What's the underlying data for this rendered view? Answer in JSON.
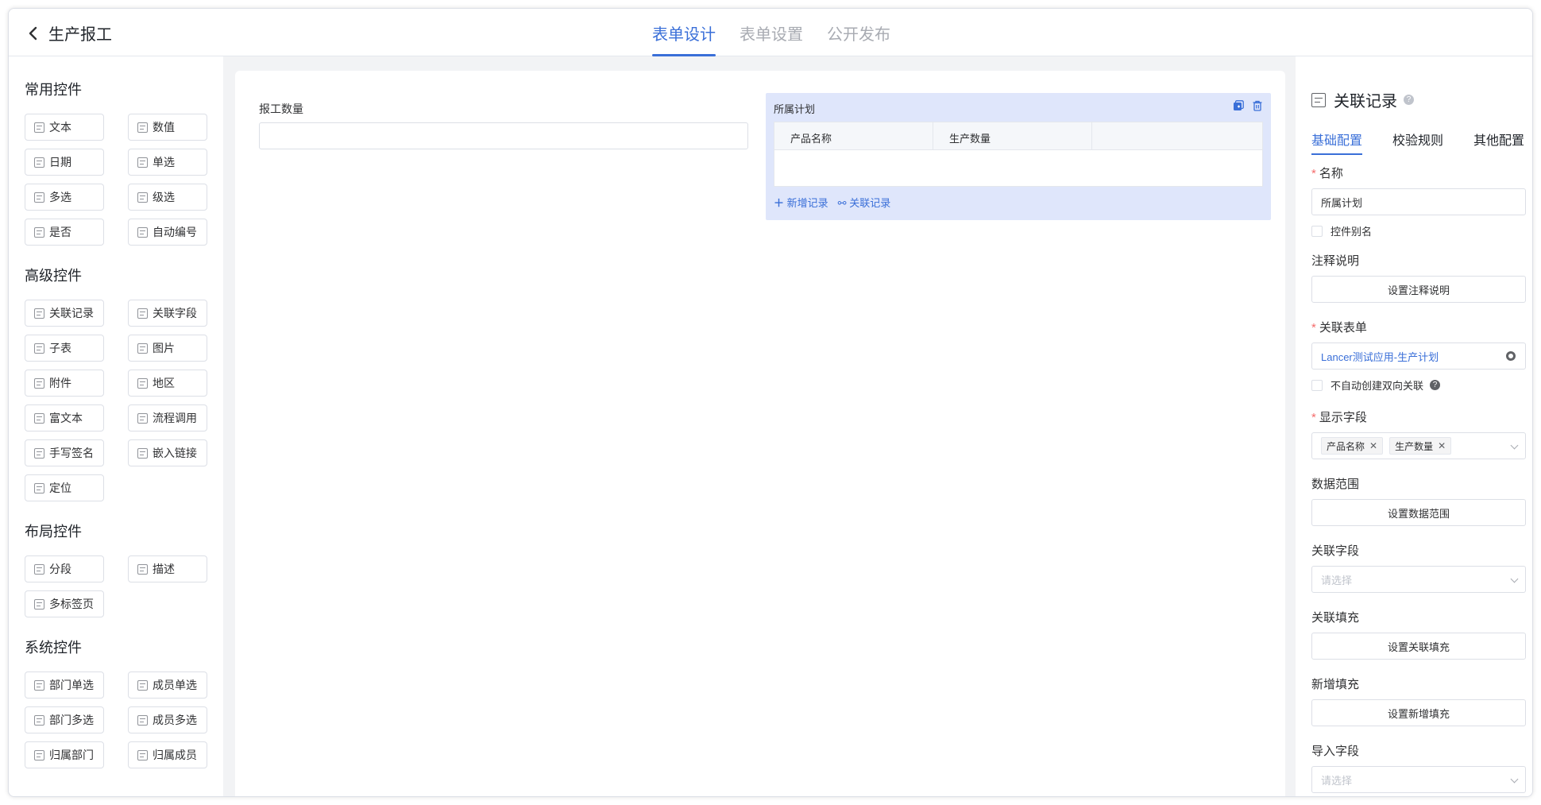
{
  "header": {
    "title": "生产报工",
    "tabs": [
      {
        "label": "表单设计",
        "active": true
      },
      {
        "label": "表单设置",
        "active": false
      },
      {
        "label": "公开发布",
        "active": false
      }
    ]
  },
  "left": {
    "groups": [
      {
        "title": "常用控件",
        "items": [
          "文本",
          "数值",
          "日期",
          "单选",
          "多选",
          "级选",
          "是否",
          "自动编号"
        ]
      },
      {
        "title": "高级控件",
        "items": [
          "关联记录",
          "关联字段",
          "子表",
          "图片",
          "附件",
          "地区",
          "富文本",
          "流程调用",
          "手写签名",
          "嵌入链接",
          "定位"
        ]
      },
      {
        "title": "布局控件",
        "items": [
          "分段",
          "描述",
          "多标签页"
        ]
      },
      {
        "title": "系统控件",
        "items": [
          "部门单选",
          "成员单选",
          "部门多选",
          "成员多选",
          "归属部门",
          "归属成员"
        ]
      }
    ]
  },
  "canvas": {
    "field1_label": "报工数量",
    "subform": {
      "label": "所属计划",
      "columns": [
        "产品名称",
        "生产数量"
      ],
      "add_label": "新增记录",
      "link_label": "关联记录"
    }
  },
  "right": {
    "title": "关联记录",
    "tabs": [
      "基础配置",
      "校验规则",
      "其他配置"
    ],
    "name_label": "名称",
    "name_value": "所属计划",
    "alias_label": "控件别名",
    "note_label": "注释说明",
    "note_btn": "设置注释说明",
    "form_label": "关联表单",
    "form_value": "Lancer测试应用-生产计划",
    "bidirect_label": "不自动创建双向关联",
    "display_label": "显示字段",
    "display_tags": [
      "产品名称",
      "生产数量"
    ],
    "range_label": "数据范围",
    "range_btn": "设置数据范围",
    "linkfield_label": "关联字段",
    "linkfield_placeholder": "请选择",
    "fill_label": "关联填充",
    "fill_btn": "设置关联填充",
    "newfill_label": "新增填充",
    "newfill_btn": "设置新增填充",
    "import_label": "导入字段",
    "import_placeholder": "请选择"
  }
}
